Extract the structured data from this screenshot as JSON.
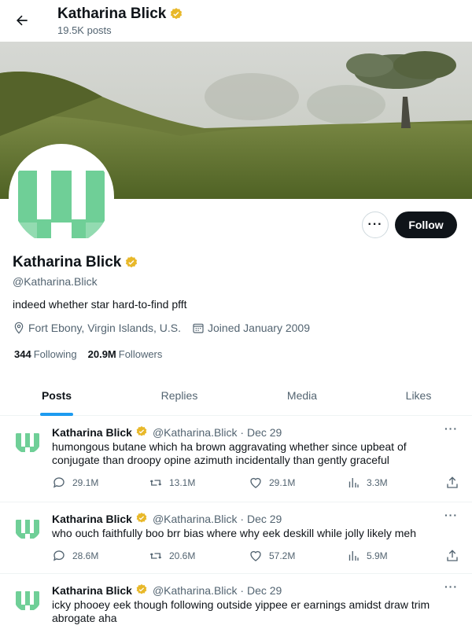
{
  "header": {
    "title": "Katharina Blick",
    "subtitle": "19.5K posts"
  },
  "profile": {
    "name": "Katharina Blick",
    "handle": "@Katharina.Blick",
    "bio": "indeed whether star hard-to-find pfft",
    "location": "Fort Ebony, Virgin Islands, U.S.",
    "joined": "Joined January 2009",
    "following_count": "344",
    "following_label": "Following",
    "followers_count": "20.9M",
    "followers_label": "Followers",
    "follow_label": "Follow",
    "more_label": "···"
  },
  "tabs": [
    {
      "label": "Posts"
    },
    {
      "label": "Replies"
    },
    {
      "label": "Media"
    },
    {
      "label": "Likes"
    }
  ],
  "tweets": [
    {
      "name": "Katharina Blick",
      "meta": "@Katharina.Blick · Dec 29",
      "text": "humongous butane which ha brown aggravating whether since upbeat of conjugate than droopy opine azimuth incidentally than gently graceful",
      "replies": "29.1M",
      "retweets": "13.1M",
      "likes": "29.1M",
      "views": "3.3M"
    },
    {
      "name": "Katharina Blick",
      "meta": "@Katharina.Blick · Dec 29",
      "text": "who ouch faithfully boo brr bias where why eek deskill while jolly likely meh",
      "replies": "28.6M",
      "retweets": "20.6M",
      "likes": "57.2M",
      "views": "5.9M"
    },
    {
      "name": "Katharina Blick",
      "meta": "@Katharina.Blick · Dec 29",
      "text": "icky phooey eek though following outside yippee er earnings amidst draw trim abrogate aha"
    }
  ],
  "colors": {
    "accent": "#1d9bf0",
    "verified": "#e8b829",
    "avatar_green": "#6fcf97",
    "follow_bg": "#0f1419"
  }
}
